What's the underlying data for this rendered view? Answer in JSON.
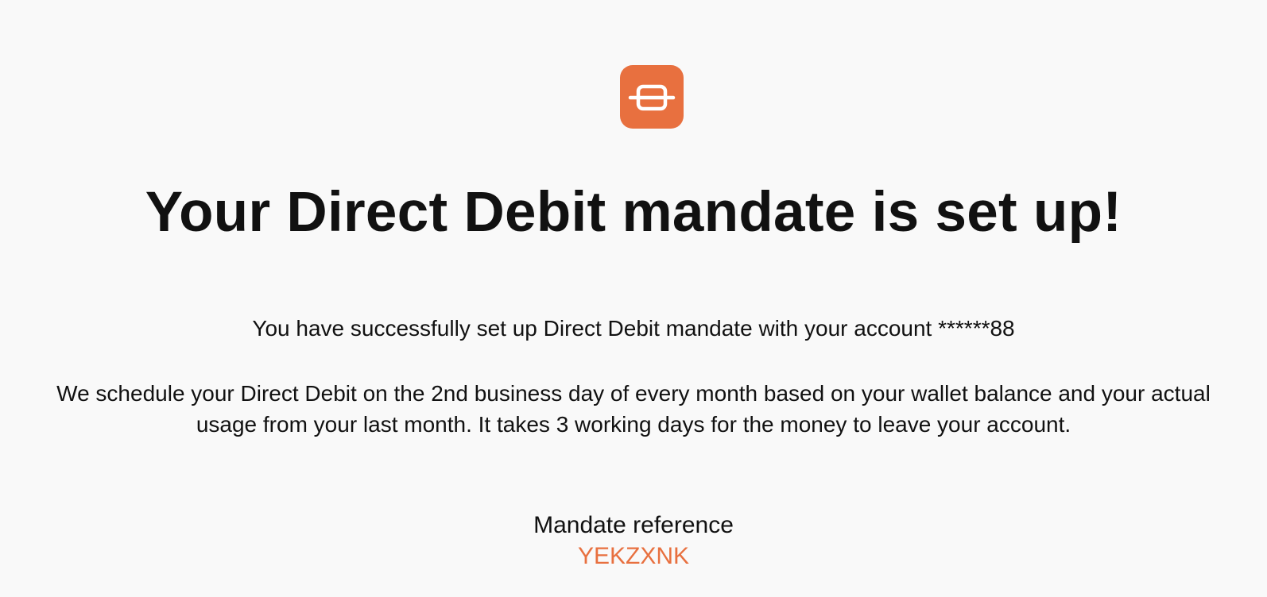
{
  "brand": {
    "logo_icon": "hanger-box-icon",
    "accent_color": "#e8703f"
  },
  "confirmation": {
    "title": "Your Direct Debit mandate is set up!",
    "success_message": "You have successfully set up Direct Debit mandate with your account ******88",
    "schedule_message": "We schedule your Direct Debit on the 2nd business day of every month based on your wallet balance and your actual usage from your last month. It takes 3 working days for the money to leave your account."
  },
  "mandate": {
    "label": "Mandate reference",
    "reference": "YEKZXNK"
  }
}
